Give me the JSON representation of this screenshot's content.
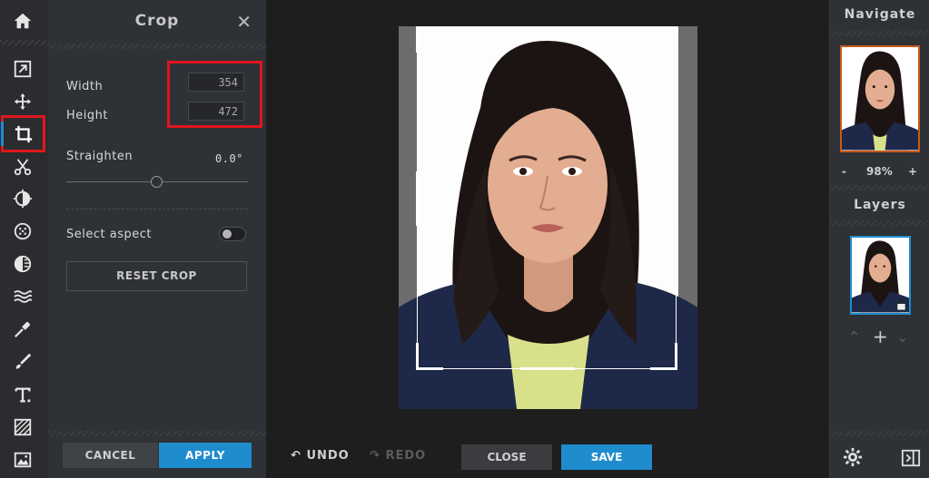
{
  "toolbar": {
    "tools": [
      {
        "name": "home-icon"
      },
      {
        "name": "export-icon"
      },
      {
        "name": "move-icon"
      },
      {
        "name": "crop-icon",
        "active": true
      },
      {
        "name": "cut-icon"
      },
      {
        "name": "adjust-icon"
      },
      {
        "name": "filter-icon"
      },
      {
        "name": "vignette-icon"
      },
      {
        "name": "wave-icon"
      },
      {
        "name": "dropper-icon"
      },
      {
        "name": "brush-icon"
      },
      {
        "name": "text-icon"
      },
      {
        "name": "texture-icon"
      },
      {
        "name": "image-icon"
      }
    ]
  },
  "panel": {
    "title": "Crop",
    "close": "✕",
    "width_label": "Width",
    "width_value": "354",
    "height_label": "Height",
    "height_value": "472",
    "straighten_label": "Straighten",
    "straighten_value": "0.0°",
    "select_aspect_label": "Select aspect",
    "reset_label": "RESET CROP",
    "cancel_label": "CANCEL",
    "apply_label": "APPLY"
  },
  "canvas": {
    "undo_label": "UNDO",
    "redo_label": "REDO",
    "close_label": "CLOSE",
    "save_label": "SAVE"
  },
  "right": {
    "navigate_title": "Navigate",
    "zoom_minus": "-",
    "zoom_value": "98%",
    "zoom_plus": "+",
    "layers_title": "Layers",
    "layer_up": "⌃",
    "layer_add": "+",
    "layer_down": "⌄"
  },
  "colors": {
    "accent": "#1f8ccd",
    "highlight": "#e0161c"
  }
}
